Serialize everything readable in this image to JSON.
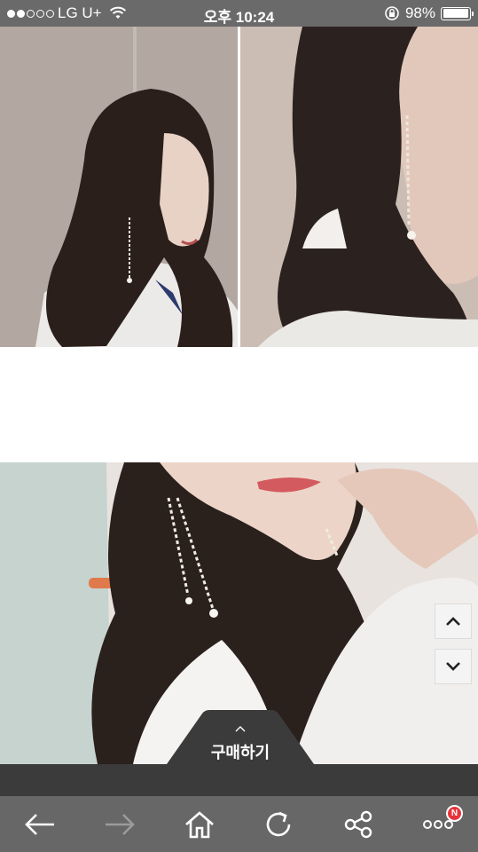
{
  "status_bar": {
    "carrier": "LG U+",
    "time": "오후 10:24",
    "battery_percent": "98%",
    "battery_level": 0.98,
    "signal_bars_filled": 2,
    "signal_bars_total": 5
  },
  "photos": [
    {
      "icon": "product-photo"
    },
    {
      "icon": "product-photo"
    },
    {
      "icon": "product-photo"
    }
  ],
  "scroll": {
    "up_icon": "chevron-up-icon",
    "down_icon": "chevron-down-icon"
  },
  "buy": {
    "label": "구매하기",
    "icon": "chevron-up-icon"
  },
  "toolbar": {
    "items": [
      {
        "icon": "back-arrow-icon",
        "enabled": true
      },
      {
        "icon": "forward-arrow-icon",
        "enabled": false
      },
      {
        "icon": "home-icon",
        "enabled": true
      },
      {
        "icon": "refresh-icon",
        "enabled": true
      },
      {
        "icon": "share-icon",
        "enabled": true
      },
      {
        "icon": "more-icon",
        "enabled": true
      }
    ],
    "badge": "N"
  },
  "colors": {
    "status_bar": "#6a6a6a",
    "toolbar": "#676767",
    "buy_bar": "#3b3b3b",
    "badge": "#e8323a",
    "disabled_icon": "#9b9b9b"
  }
}
